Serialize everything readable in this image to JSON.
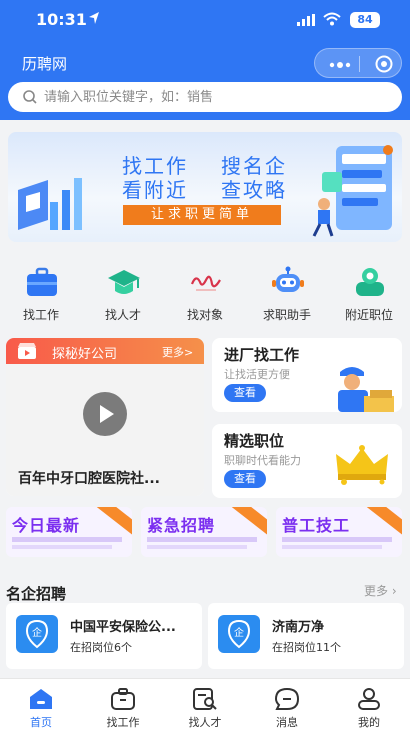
{
  "status_bar": {
    "time": "10:31",
    "battery": "84"
  },
  "app": {
    "title": "历聘网"
  },
  "search": {
    "placeholder": "请输入职位关键字，如：销售"
  },
  "banner": {
    "line1": "找工作",
    "line2": "看附近",
    "line3": "搜名企",
    "line4": "查攻略",
    "cta": "让求职更简单"
  },
  "quick_nav": [
    {
      "label": "找工作",
      "icon": "briefcase-icon"
    },
    {
      "label": "找人才",
      "icon": "graduation-cap-icon"
    },
    {
      "label": "找对象",
      "icon": "heart-script-icon"
    },
    {
      "label": "求职助手",
      "icon": "robot-icon"
    },
    {
      "label": "附近职位",
      "icon": "location-person-icon"
    }
  ],
  "company_showcase": {
    "header": "探秘好公司",
    "more": "更多>",
    "name": "百年中牙口腔医院社..."
  },
  "factory_card": {
    "title": "进厂找工作",
    "subtitle": "让找活更方便",
    "button": "查看"
  },
  "selected_card": {
    "title": "精选职位",
    "subtitle": "职聊时代看能力",
    "button": "查看"
  },
  "promo_tiles": [
    {
      "title": "今日最新"
    },
    {
      "title": "紧急招聘"
    },
    {
      "title": "普工技工"
    }
  ],
  "famous": {
    "title": "名企招聘",
    "more": "更多",
    "items": [
      {
        "name": "中国平安保险公...",
        "count": "在招岗位6个"
      },
      {
        "name": "济南万净",
        "count": "在招岗位11个"
      }
    ]
  },
  "tabbar": [
    {
      "label": "首页",
      "icon": "home-icon",
      "active": true
    },
    {
      "label": "找工作",
      "icon": "briefcase-icon"
    },
    {
      "label": "找人才",
      "icon": "search-people-icon"
    },
    {
      "label": "消息",
      "icon": "message-icon"
    },
    {
      "label": "我的",
      "icon": "user-icon"
    }
  ],
  "colors": {
    "primary": "#2f76f3",
    "accent": "#f07c1c",
    "purple": "#7b2ff0"
  }
}
